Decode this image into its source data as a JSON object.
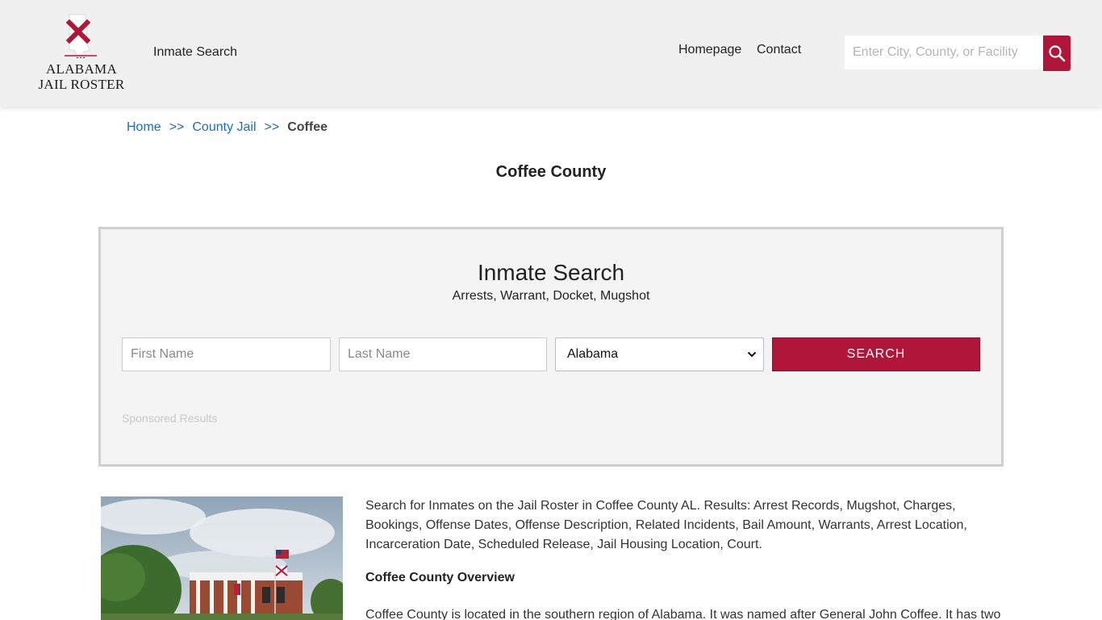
{
  "header": {
    "logo_line1": "ALABAMA",
    "logo_line2": "JAIL ROSTER",
    "nav_inmate_search": "Inmate Search",
    "nav_homepage": "Homepage",
    "nav_contact": "Contact",
    "search_placeholder": "Enter City, County, or Facility",
    "search_icon": "search-icon"
  },
  "breadcrumb": {
    "home": "Home",
    "sep1": ">>",
    "county_jail": "County Jail",
    "sep2": ">>",
    "current": "Coffee"
  },
  "page_title": "Coffee County",
  "inmate_search": {
    "title": "Inmate Search",
    "subtitle": "Arrests, Warrant, Docket, Mugshot",
    "first_name_placeholder": "First Name",
    "last_name_placeholder": "Last Name",
    "state_selected": "Alabama",
    "search_button": "SEARCH",
    "sponsored": "Sponsored Results"
  },
  "content": {
    "intro": "Search for Inmates on the Jail Roster in Coffee County AL. Results: Arrest Records, Mugshot, Charges, Bookings, Offense Dates, Offense Description, Related Incidents, Bail Amount, Warrants, Arrest Location, Incarceration Date, Scheduled Release, Jail Housing Location, Court.",
    "overview_heading": "Coffee County Overview",
    "overview_text": "Coffee County is located in the southern region of Alabama. It was named after General John Coffee. It has two"
  },
  "colors": {
    "accent": "#b0163a",
    "link": "#1a6fc4",
    "header_bg": "#f0f0f0"
  }
}
